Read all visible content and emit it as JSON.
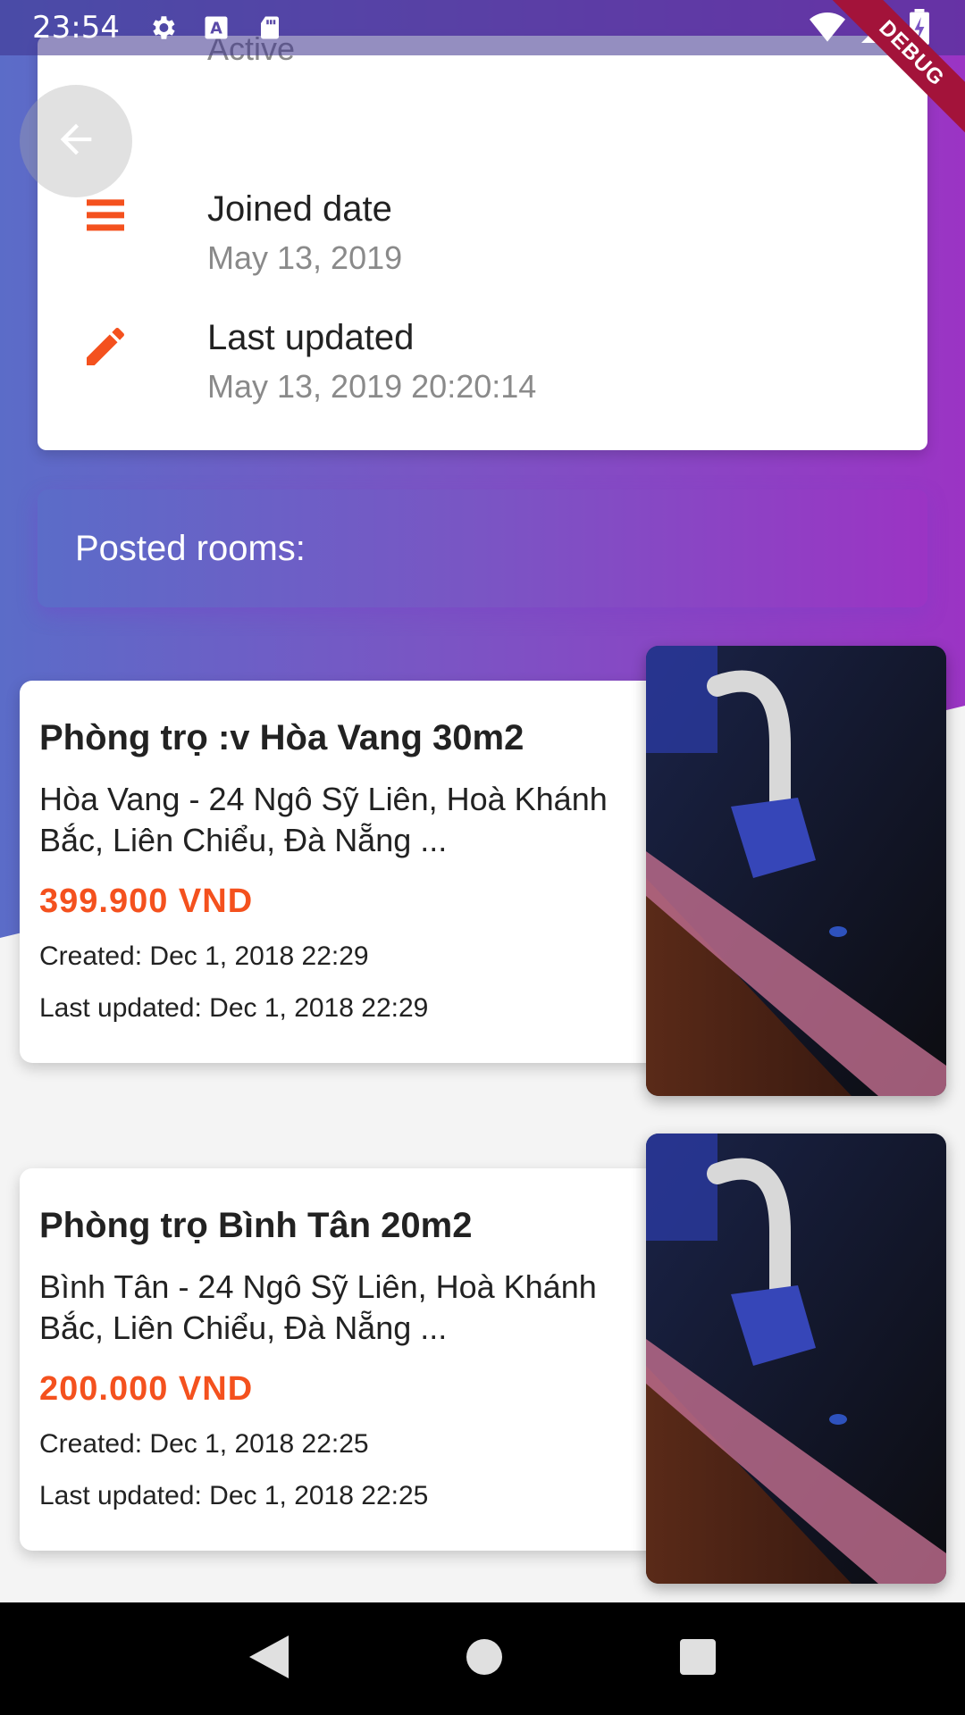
{
  "status_bar": {
    "time": "23:54",
    "debug_label": "DEBUG",
    "icons": [
      "settings-icon",
      "text-a-icon",
      "sd-card-icon",
      "wifi-icon",
      "signal-icon",
      "battery-charging-icon"
    ]
  },
  "profile_info": {
    "partial_label": "Active",
    "rows": [
      {
        "icon": "calendar-icon",
        "title": "Joined date",
        "value": "May 13, 2019"
      },
      {
        "icon": "pencil-icon",
        "title": "Last updated",
        "value": "May 13, 2019 20:20:14"
      }
    ]
  },
  "back_button": {
    "icon": "arrow-back-icon"
  },
  "posted_header": {
    "label": "Posted rooms:"
  },
  "rooms": [
    {
      "title": "Phòng trọ :v Hòa Vang 30m2",
      "address": "Hòa Vang - 24 Ngô Sỹ Liên, Hoà Khánh Bắc, Liên Chiểu, Đà Nẵng ...",
      "price": "399.900 VND",
      "created": "Created: Dec 1, 2018 22:29",
      "updated": "Last updated: Dec 1, 2018 22:29"
    },
    {
      "title": "Phòng trọ Bình Tân 20m2",
      "address": "Bình Tân - 24 Ngô Sỹ Liên, Hoà Khánh Bắc, Liên Chiểu, Đà Nẵng ...",
      "price": "200.000 VND",
      "created": "Created: Dec 1, 2018 22:25",
      "updated": "Last updated: Dec 1, 2018 22:25"
    }
  ],
  "nav_bar": {
    "icons": [
      "back-triangle-icon",
      "home-circle-icon",
      "recents-square-icon"
    ]
  },
  "colors": {
    "accent": "#f4511e",
    "gradient_start": "#5b6cc8",
    "gradient_end": "#9b34c4"
  }
}
